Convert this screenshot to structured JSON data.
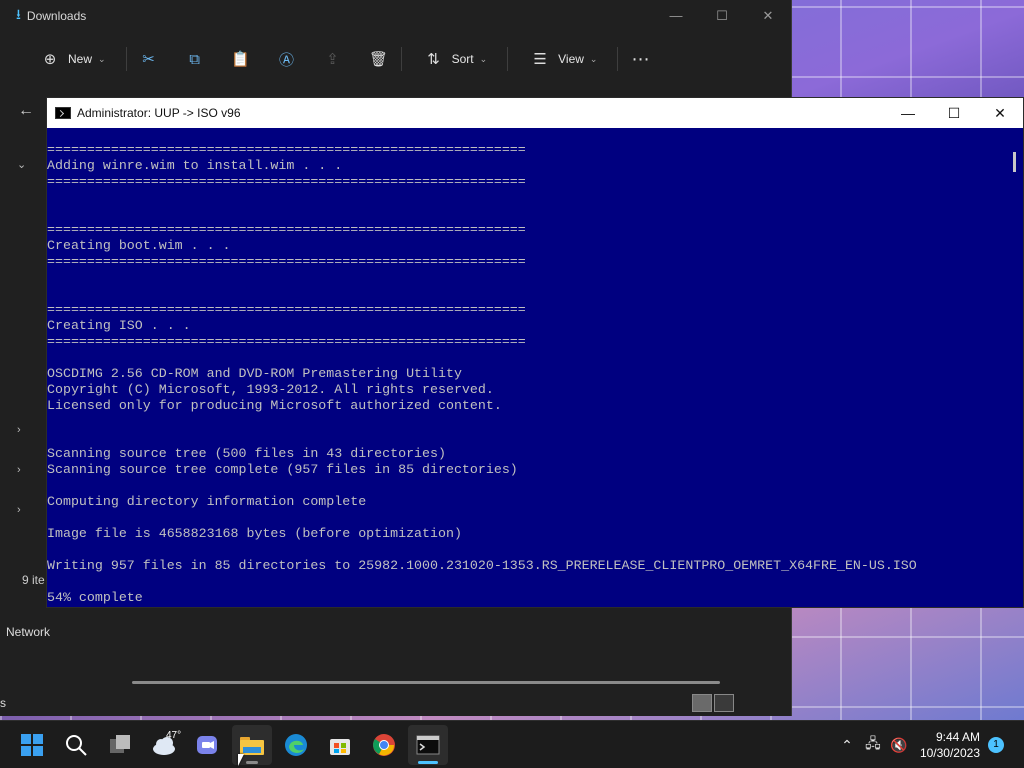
{
  "explorer": {
    "title": "Downloads",
    "toolbar": {
      "new_label": "New",
      "sort_label": "Sort",
      "view_label": "View"
    },
    "status": "9 ite",
    "nav_network": "Network",
    "bottom_left": "s"
  },
  "console": {
    "title": "Administrator:  UUP -> ISO v96",
    "lines": [
      "============================================================",
      "Adding winre.wim to install.wim . . .",
      "============================================================",
      "",
      "",
      "============================================================",
      "Creating boot.wim . . .",
      "============================================================",
      "",
      "",
      "============================================================",
      "Creating ISO . . .",
      "============================================================",
      "",
      "OSCDIMG 2.56 CD-ROM and DVD-ROM Premastering Utility",
      "Copyright (C) Microsoft, 1993-2012. All rights reserved.",
      "Licensed only for producing Microsoft authorized content.",
      "",
      "",
      "Scanning source tree (500 files in 43 directories)",
      "Scanning source tree complete (957 files in 85 directories)",
      "",
      "Computing directory information complete",
      "",
      "Image file is 4658823168 bytes (before optimization)",
      "",
      "Writing 957 files in 85 directories to 25982.1000.231020-1353.RS_PRERELEASE_CLIENTPRO_OEMRET_X64FRE_EN-US.ISO",
      "",
      "54% complete"
    ]
  },
  "taskbar": {
    "weather_temp": "47°",
    "time": "9:44 AM",
    "date": "10/30/2023",
    "notification_count": "1"
  }
}
